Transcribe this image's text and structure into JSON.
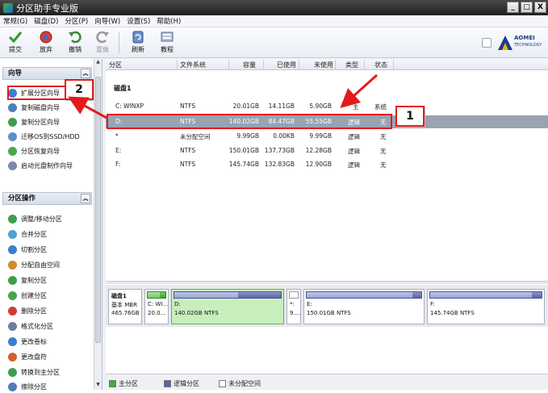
{
  "window": {
    "title": "分区助手专业版",
    "controls": [
      "_",
      "□",
      "X"
    ]
  },
  "menu": [
    "常规(G)",
    "磁盘(D)",
    "分区(P)",
    "向导(W)",
    "设置(S)",
    "帮助(H)"
  ],
  "toolbar": {
    "buttons": [
      {
        "label": "提交",
        "icon": "check-icon",
        "enabled": true
      },
      {
        "label": "放弃",
        "icon": "discard-icon",
        "enabled": true
      },
      {
        "label": "撤销",
        "icon": "undo-icon",
        "enabled": true
      },
      {
        "label": "重做",
        "icon": "redo-icon",
        "enabled": false
      },
      {
        "label": "刷新",
        "icon": "refresh-icon",
        "enabled": true
      },
      {
        "label": "教程",
        "icon": "tutorial-icon",
        "enabled": true
      }
    ],
    "logo_line1": "AOMEI",
    "logo_line2": "TECHNOLOGY"
  },
  "sidebar": {
    "wizard": {
      "title": "向导",
      "items": [
        "扩展分区向导",
        "复制磁盘向导",
        "复制分区向导",
        "迁移OS到SSD/HDD",
        "分区恢复向导",
        "启动光盘制作向导"
      ]
    },
    "operations": {
      "title": "分区操作",
      "items": [
        "调整/移动分区",
        "合并分区",
        "切割分区",
        "分配自由空间",
        "复制分区",
        "创建分区",
        "删除分区",
        "格式化分区",
        "更改卷标",
        "更改盘符",
        "转换到主分区",
        "擦除分区"
      ]
    }
  },
  "table": {
    "columns": [
      "分区",
      "文件系统",
      "容量",
      "已使用",
      "未使用",
      "类型",
      "状态"
    ],
    "disk_label": "磁盘1",
    "rows": [
      {
        "partition": "C: WINXP",
        "fs": "NTFS",
        "capacity": "20.01GB",
        "used": "14.11GB",
        "free": "5.90GB",
        "type": "主",
        "status": "系统",
        "selected": false
      },
      {
        "partition": "D:",
        "fs": "NTFS",
        "capacity": "140.02GB",
        "used": "84.47GB",
        "free": "55.55GB",
        "type": "逻辑",
        "status": "无",
        "selected": true
      },
      {
        "partition": "*",
        "fs": "未分配空间",
        "capacity": "9.99GB",
        "used": "0.00KB",
        "free": "9.99GB",
        "type": "逻辑",
        "status": "无",
        "selected": false
      },
      {
        "partition": "E:",
        "fs": "NTFS",
        "capacity": "150.01GB",
        "used": "137.73GB",
        "free": "12.28GB",
        "type": "逻辑",
        "status": "无",
        "selected": false
      },
      {
        "partition": "F:",
        "fs": "NTFS",
        "capacity": "145.74GB",
        "used": "132.83GB",
        "free": "12.90GB",
        "type": "逻辑",
        "status": "无",
        "selected": false
      }
    ]
  },
  "diskmap": {
    "disk_name": "磁盘1",
    "disk_type": "基本 MBR",
    "disk_size": "465.76GB",
    "blocks": [
      {
        "name": "C: WI...",
        "detail": "20.0...",
        "used_fraction": 0.7,
        "selected": false
      },
      {
        "name": "D:",
        "detail": "140.02GB NTFS",
        "used_fraction": 0.6,
        "selected": true
      },
      {
        "name": "*:",
        "detail": "9....",
        "used_fraction": 0,
        "selected": false
      },
      {
        "name": "E:",
        "detail": "150.01GB NTFS",
        "used_fraction": 0.92,
        "selected": false
      },
      {
        "name": "F:",
        "detail": "145.74GB NTFS",
        "used_fraction": 0.91,
        "selected": false
      }
    ]
  },
  "legend": [
    {
      "label": "主分区",
      "color": "#3cae3c"
    },
    {
      "label": "逻辑分区",
      "color": "#5a63a8"
    },
    {
      "label": "未分配空间",
      "color": "#ffffff"
    }
  ],
  "callouts": {
    "one": "1",
    "two": "2"
  },
  "colors": {
    "annotation_red": "#e31b1b",
    "selection": "#9aa3b2"
  }
}
